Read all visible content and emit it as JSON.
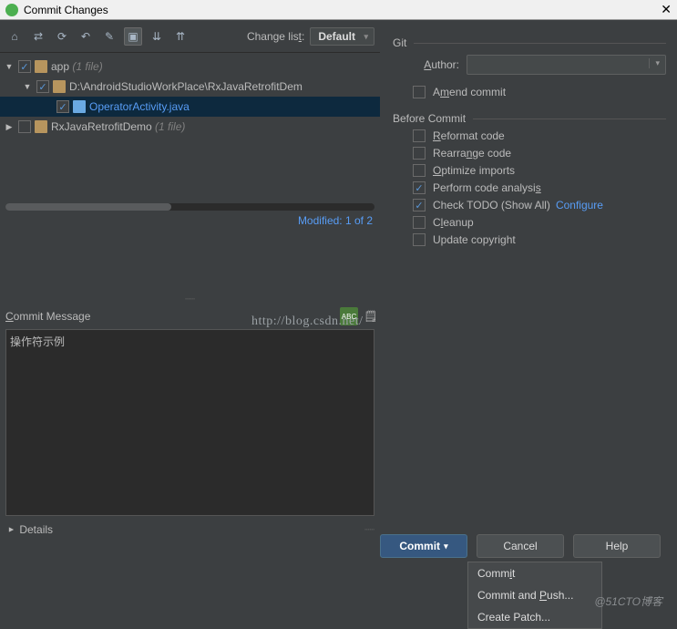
{
  "title": "Commit Changes",
  "toolbar": {
    "changeListLabel": "Change list:",
    "changeListValue": "Default"
  },
  "tree": {
    "app": {
      "name": "app",
      "hint": "(1 file)"
    },
    "path": "D:\\AndroidStudioWorkPlace\\RxJavaRetrofitDem",
    "file": "OperatorActivity.java",
    "demo": {
      "name": "RxJavaRetrofitDemo",
      "hint": "(1 file)"
    }
  },
  "modified": "Modified: 1 of 2",
  "commitMsgLabel": "Commit Message",
  "commitMsgValue": "操作符示例",
  "detailsLabel": "Details",
  "git": {
    "section": "Git",
    "authorLabel": "Author:",
    "amendLabel": "Amend commit"
  },
  "before": {
    "section": "Before Commit",
    "reformat": "Reformat code",
    "rearrange": "Rearrange code",
    "optimize": "Optimize imports",
    "analysis": "Perform code analysis",
    "todo": "Check TODO (Show All)",
    "configure": "Configure",
    "cleanup": "Cleanup",
    "copyright": "Update copyright"
  },
  "buttons": {
    "commit": "Commit",
    "cancel": "Cancel",
    "help": "Help"
  },
  "menu": {
    "commit": "Commit",
    "commitPush": "Commit and Push...",
    "patch": "Create Patch..."
  },
  "watermark1": "http://blog.csdn.net/",
  "watermark2": "@51CTO博客"
}
